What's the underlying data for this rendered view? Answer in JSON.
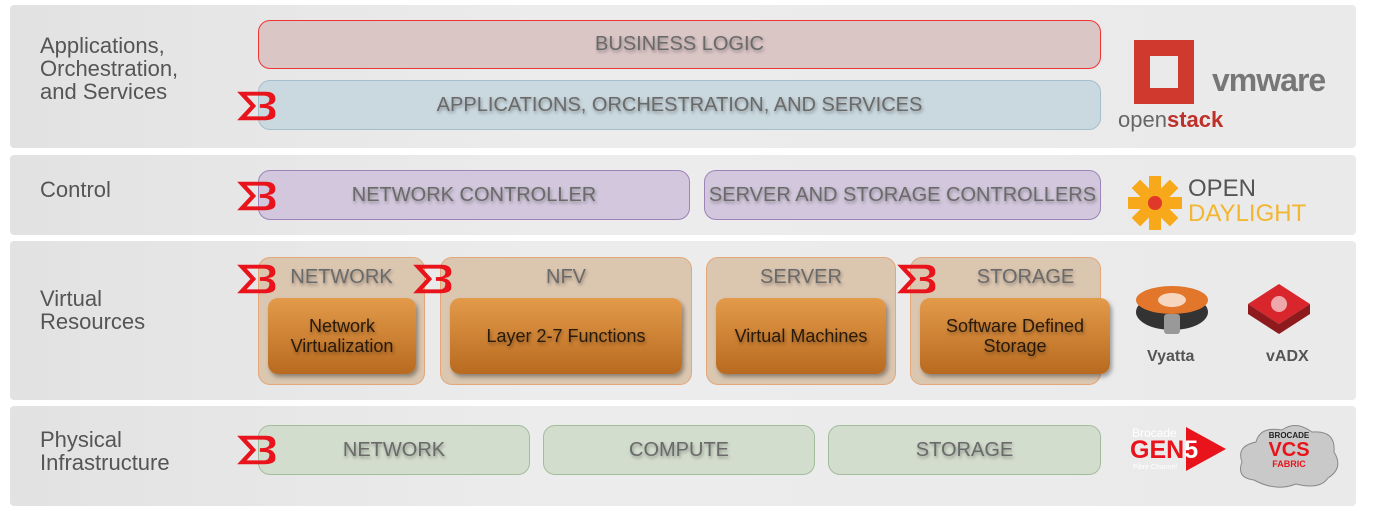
{
  "layers": {
    "apps": {
      "label": "Applications,\nOrchestration,\nand Services",
      "business_logic": "BUSINESS LOGIC",
      "apps_box": "APPLICATIONS, ORCHESTRATION, AND SERVICES"
    },
    "control": {
      "label": "Control",
      "network_controller": "NETWORK CONTROLLER",
      "server_storage": "SERVER AND STORAGE CONTROLLERS"
    },
    "virtual": {
      "label": "Virtual\nResources",
      "groups": [
        {
          "title": "NETWORK",
          "inner": "Network Virtualization"
        },
        {
          "title": "NFV",
          "inner": "Layer 2-7 Functions"
        },
        {
          "title": "SERVER",
          "inner": "Virtual Machines"
        },
        {
          "title": "STORAGE",
          "inner": "Software Defined Storage"
        }
      ]
    },
    "physical": {
      "label": "Physical\nInfrastructure",
      "boxes": [
        "NETWORK",
        "COMPUTE",
        "STORAGE"
      ]
    }
  },
  "logos": {
    "openstack": {
      "a": "open",
      "b": "stack"
    },
    "vmware": "vmware",
    "opendaylight": {
      "a": "OPEN",
      "b": "DAYLIGHT"
    },
    "vyatta": "Vyatta",
    "vadx": "vADX",
    "gen5": {
      "brand": "Brocade",
      "name": "GEN",
      "num": "5",
      "sub": "Fibre Channel"
    },
    "vcs": {
      "brand": "BROCADE",
      "name": "VCS",
      "sub": "FABRIC"
    }
  },
  "colors": {
    "brocade_red": "#e8131b",
    "orange": "#d1802f"
  }
}
